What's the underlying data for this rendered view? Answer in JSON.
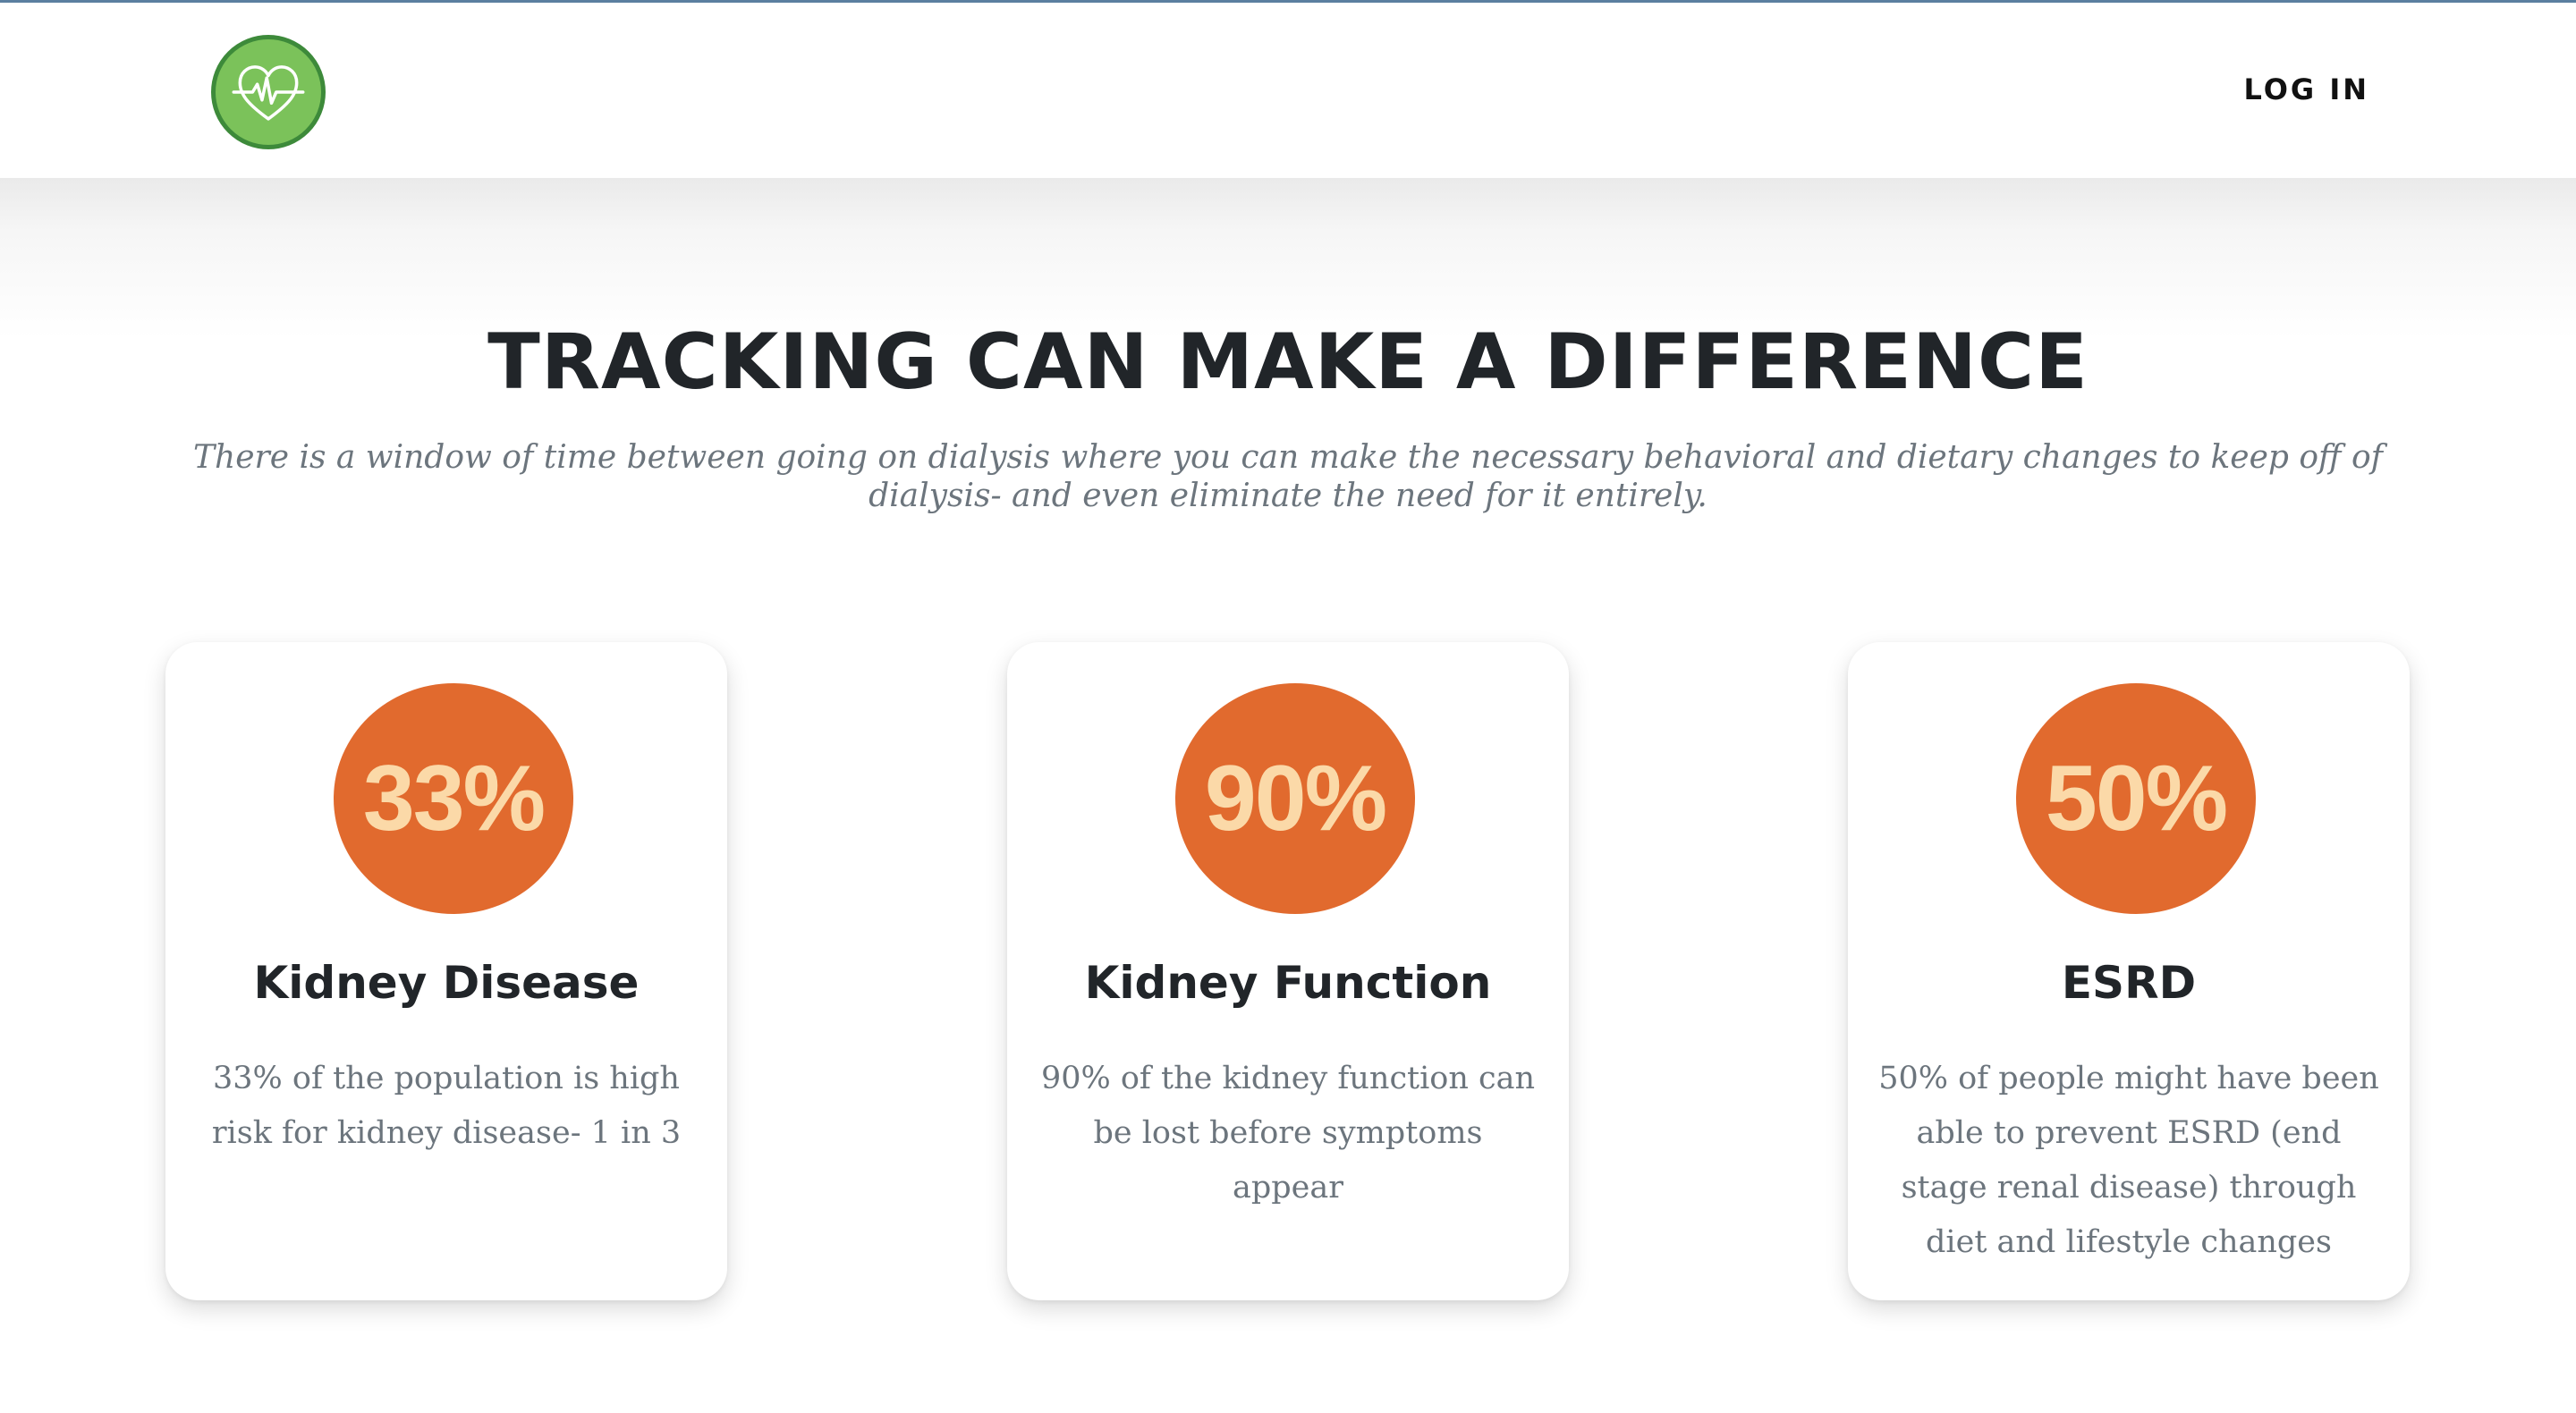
{
  "navbar": {
    "logo_icon": "heart-pulse-icon",
    "login_label": "LOG IN"
  },
  "hero": {
    "title": "TRACKING CAN MAKE A DIFFERENCE",
    "subtitle": "There is a window of time between going on dialysis where you can make the necessary behavioral and dietary changes to keep off of dialysis- and even eliminate the need for it entirely."
  },
  "cards": [
    {
      "stat": "33%",
      "title": "Kidney Disease",
      "text": "33% of the population is high risk for kidney disease- 1 in 3"
    },
    {
      "stat": "90%",
      "title": "Kidney Function",
      "text": "90% of the kidney function can be lost before symptoms appear"
    },
    {
      "stat": "50%",
      "title": "ESRD",
      "text": "50% of people might have been able to prevent ESRD (end stage renal disease) through diet and lifestyle changes"
    }
  ],
  "colors": {
    "accent_orange": "#e16a2e",
    "stat_text": "#fbd9a8",
    "logo_green": "#7bc25a",
    "logo_border": "#3d8a3a",
    "heading": "#212529",
    "muted": "#6c757d"
  }
}
